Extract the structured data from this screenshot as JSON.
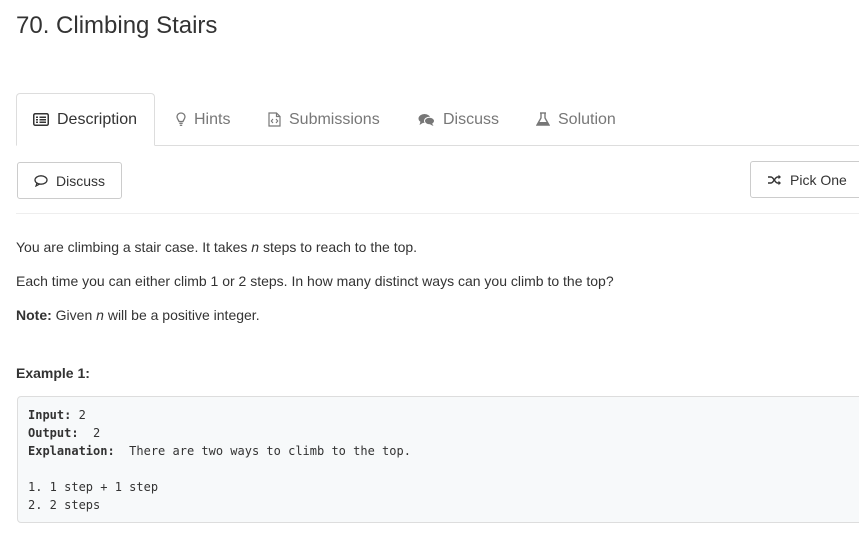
{
  "problem": {
    "title": "70. Climbing Stairs"
  },
  "tabs": [
    {
      "label": "Description",
      "icon": "list-icon",
      "active": true
    },
    {
      "label": "Hints",
      "icon": "lightbulb-icon",
      "active": false
    },
    {
      "label": "Submissions",
      "icon": "file-code-icon",
      "active": false
    },
    {
      "label": "Discuss",
      "icon": "comments-icon",
      "active": false
    },
    {
      "label": "Solution",
      "icon": "flask-icon",
      "active": false
    }
  ],
  "toolbar": {
    "discuss_label": "Discuss",
    "pick_one_label": "Pick One"
  },
  "description": {
    "line1_a": "You are climbing a stair case. It takes ",
    "line1_var": "n",
    "line1_b": " steps to reach to the top.",
    "line2": "Each time you can either climb 1 or 2 steps. In how many distinct ways can you climb to the top?",
    "note_label": "Note:",
    "note_a": " Given ",
    "note_var": "n",
    "note_b": " will be a positive integer."
  },
  "example": {
    "title": "Example 1:",
    "input_label": "Input:",
    "input_value": " 2",
    "output_label": "Output:",
    "output_value": "  2",
    "explanation_label": "Explanation:",
    "explanation_value": "  There are two ways to climb to the top.",
    "step1": "1. 1 step + 1 step",
    "step2": "2. 2 steps"
  },
  "colors": {
    "text": "#333333",
    "muted": "#777777",
    "border": "#dddddd",
    "code_bg": "#f7f9fa"
  }
}
